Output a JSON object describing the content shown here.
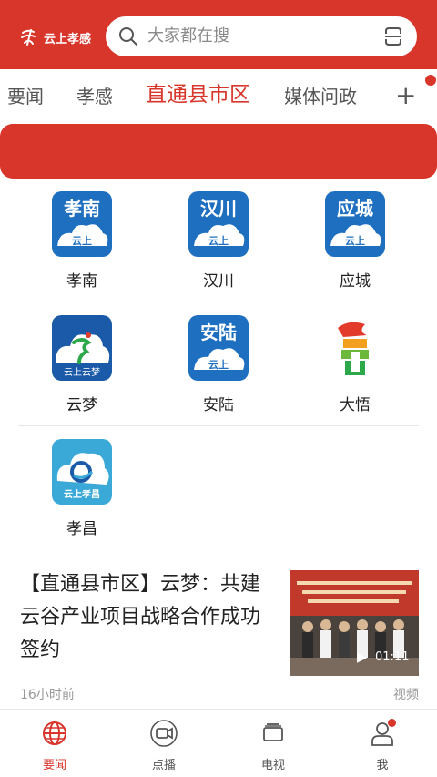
{
  "header": {
    "logo_text": "云上孝感",
    "search_placeholder": "大家都在搜",
    "brand_color": "#d8352b"
  },
  "tabs": [
    {
      "label": "要闻",
      "active": false
    },
    {
      "label": "孝感",
      "active": false
    },
    {
      "label": "直通县市区",
      "active": true
    },
    {
      "label": "媒体问政",
      "active": false
    }
  ],
  "tab_plus": "+",
  "grid": [
    {
      "label": "孝南",
      "icon_title": "孝南",
      "icon_sub": "云上",
      "icon": "xiaonan-app-icon"
    },
    {
      "label": "汉川",
      "icon_title": "汉川",
      "icon_sub": "云上",
      "icon": "hanchuan-app-icon"
    },
    {
      "label": "应城",
      "icon_title": "应城",
      "icon_sub": "云上",
      "icon": "yingcheng-app-icon"
    },
    {
      "label": "云梦",
      "icon_title": "",
      "icon_sub": "云上云梦",
      "icon": "yunmeng-app-icon"
    },
    {
      "label": "安陆",
      "icon_title": "安陆",
      "icon_sub": "云上",
      "icon": "anlu-app-icon"
    },
    {
      "label": "大悟",
      "icon_title": "",
      "icon_sub": "",
      "icon": "dawu-app-icon"
    },
    {
      "label": "孝昌",
      "icon_title": "",
      "icon_sub": "云上孝昌",
      "icon": "xiaochang-app-icon"
    }
  ],
  "news": {
    "title": "【直通县市区】云梦：共建云谷产业项目战略合作成功签约",
    "time": "16小时前",
    "type": "视频",
    "duration": "01:11"
  },
  "bottom_nav": [
    {
      "label": "要闻",
      "icon": "globe-icon",
      "active": true
    },
    {
      "label": "点播",
      "icon": "video-camera-icon",
      "active": false
    },
    {
      "label": "电视",
      "icon": "tv-icon",
      "active": false
    },
    {
      "label": "我",
      "icon": "user-icon",
      "active": false
    }
  ]
}
